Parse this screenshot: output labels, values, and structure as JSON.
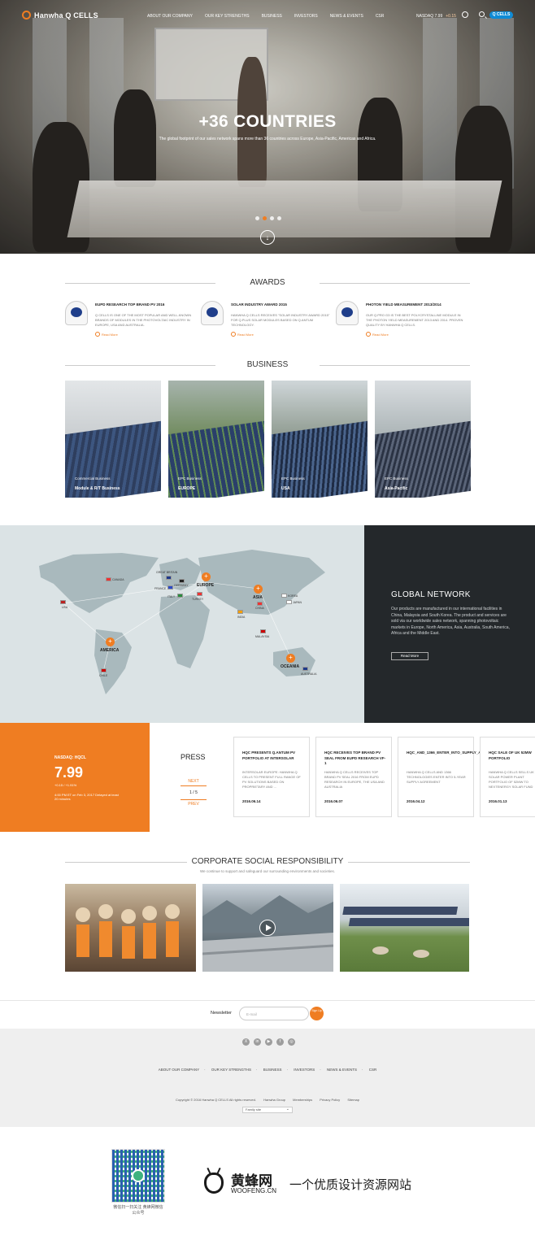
{
  "header": {
    "logo": "Hanwha Q CELLS",
    "menu": [
      "ABOUT OUR COMPANY",
      "OUR KEY STRENGTHS",
      "BUSINESS",
      "INVESTORS",
      "NEWS & EVENTS",
      "CSR"
    ],
    "nasdaq_label": "NASDAQ 7.99",
    "nasdaq_change": "+0.15",
    "qcells_button": "Q CELLS"
  },
  "hero": {
    "title": "+36 COUNTRIES",
    "subtitle": "The global footprint of our sales network spans more than 36 countries across Europe, Asia-Pacific, Americas and Africa.",
    "active_slide": 2,
    "slide_count": 4
  },
  "awards": {
    "title": "AWARDS",
    "items": [
      {
        "title": "EUPD RESEARCH TOP BRAND PV 2016",
        "desc": "Q CELLS IS ONE OF THE MOST POPULAR AND WELL-KNOWN BRANDS OF MODULES IN THE PHOTOVOLTAIC INDUSTRY IN EUROPE, USA AND AUSTRALIA.",
        "more": "Read More"
      },
      {
        "title": "SOLAR INDUSTRY AWARD 2015",
        "desc": "HANWHA Q CELLS RECEIVES \"SOLAR INDUSTRY AWARD 2015\" FOR Q.PLUS SOLAR MODULES BASED ON Q.ANTUM TECHNOLOGY.",
        "more": "Read More"
      },
      {
        "title": "PHOTON YIELD MEASUREMENT 2013/2014",
        "desc": "OUR Q.PRO G3 IS THE BEST POLYCRYSTALLINE MODULE IN THE PHOTON YIELD MEASUREMENT 2013 AND 2014. PROVEN QUALITY BY HANWHA Q CELLS.",
        "more": "Read More"
      }
    ]
  },
  "business": {
    "title": "BUSINESS",
    "items": [
      {
        "category": "Commercial Business",
        "name": "Module & R/T Business"
      },
      {
        "category": "EPC Business",
        "name": "EUROPE"
      },
      {
        "category": "EPC Business",
        "name": "USA"
      },
      {
        "category": "EPC Business",
        "name": "Asia-Pacific"
      }
    ]
  },
  "map": {
    "regions": [
      "EUROPE",
      "ASIA",
      "AMERICA",
      "OCEANIA"
    ],
    "countries": [
      "CANADA",
      "GREAT BRITAIN",
      "GERMANY",
      "FRANCE",
      "ITALY",
      "TURKEY",
      "CHINA",
      "KOREA",
      "JAPAN",
      "INDIA",
      "MALAYSIA",
      "USA",
      "CHILE",
      "AUSTRALIA"
    ]
  },
  "global_network": {
    "title": "GLOBAL NETWORK",
    "desc": "Our products are manufactured in our international facilities in China, Malaysia and South Korea. The product and services are sold via our worldwide sales network, spanning photovoltaic markets in Europe, North America, Asia, Australia, South America, Africa and the Middle East.",
    "button": "Read More"
  },
  "stock": {
    "label": "NASDAQ: HQCL",
    "value": "7.99",
    "change": "+0.15 / +1.91%",
    "note": "4:00 PM ET on Feb 3, 2017 Delayed at least 20 minutes"
  },
  "press": {
    "title": "PRESS",
    "prev": "NEXT",
    "next": "PREV",
    "page": "1 / 5",
    "items": [
      {
        "title": "HQC PRESENTS Q.ANTUM PV PORTFOLIO AT INTERSOLAR",
        "desc": "INTERSOLAR EUROPE: HANWHA Q CELLS TO PRESENT FULL RANGE OF PV SOLUTIONS BASED ON PROPRIETARY AND ...",
        "date": "2016.06.14"
      },
      {
        "title": "HQC RECEIVES TOP BRAND PV SEAL FROM EUPD RESEARCH VF-1",
        "desc": "HANWHA Q CELLS RECEIVES TOP BRAND PV SEAL 2016 FROM EUPD RESEARCH IN EUROPE, THE USA AND AUSTRALIA",
        "date": "2016.06.07"
      },
      {
        "title": "HQC_AND_1366_ENTER_INTO_SUPPLY_AGREEMENT",
        "desc": "HANWHA Q CELLS AND 1366 TECHNOLOGIES ENTER INTO 5-YEAR SUPPLY AGREEMENT",
        "date": "2016.04.12"
      },
      {
        "title": "HQC SALE OF UK 52MW PORTFOLIO",
        "desc": "HANWHA Q CELLS SELLS UK SOLAR POWER PLANT PORTFOLIO OF 52MW TO NEXTENERGY SOLAR FUND",
        "date": "2016.01.13"
      }
    ]
  },
  "csr": {
    "title": "CORPORATE SOCIAL RESPONSIBILITY",
    "subtitle": "We continue to support and safeguard our surrounding environments and societies."
  },
  "newsletter": {
    "label": "Newsletter",
    "placeholder": "E-mail",
    "button": "Sign Up"
  },
  "footer": {
    "social": [
      "X",
      "in",
      "▶",
      "f",
      "◎"
    ],
    "menu": [
      "ABOUT OUR COMPANY",
      "OUR KEY STRENGTHS",
      "BUSINESS",
      "INVESTORS",
      "NEWS & EVENTS",
      "CSR"
    ],
    "copyright": "Copyright © 2016 Hanwha Q CELLS All rights reserved.",
    "links": [
      "Hanwha Group",
      "Memberships",
      "Privacy Policy",
      "Sitemap"
    ],
    "family_site": "Family site"
  },
  "watermark": {
    "qr_caption": "微信扫一扫关注 黄蜂网微信公众号",
    "brand": "黄蜂网",
    "domain": "WOOFENG.CN",
    "slogan": "一个优质设计资源网站"
  },
  "colors": {
    "accent": "#ef7d22",
    "dark": "#24282b",
    "map_bg": "#dbe3e5",
    "link_blue": "#0f8bd6"
  }
}
